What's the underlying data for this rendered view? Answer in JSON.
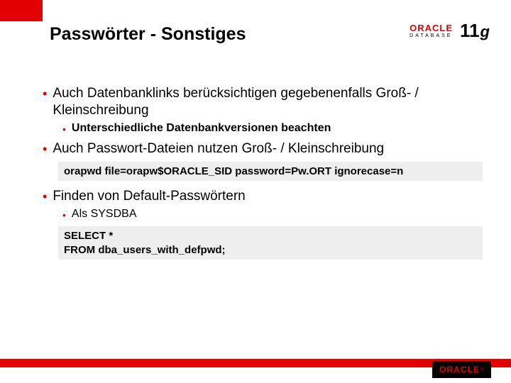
{
  "brand": {
    "wordmark": "ORACLE",
    "subtitle": "DATABASE",
    "version_number": "11",
    "version_suffix": "g",
    "registered": "®"
  },
  "title": "Passwörter - Sonstiges",
  "bullets": [
    {
      "level": 1,
      "text": "Auch Datenbanklinks berücksichtigen gegebenenfalls Groß- / Kleinschreibung"
    },
    {
      "level": 2,
      "text": "Unterschiedliche Datenbankversionen beachten",
      "bold": true
    },
    {
      "level": 1,
      "text": "Auch Passwort-Dateien nutzen Groß- / Kleinschreibung"
    }
  ],
  "code1": "orapwd file=orapw$ORACLE_SID password=Pw.ORT ignorecase=n",
  "bullets2": [
    {
      "level": 1,
      "text": "Finden von Default-Passwörtern"
    },
    {
      "level": 2,
      "text": "Als SYSDBA",
      "bold": false
    }
  ],
  "code2_line1": "SELECT *",
  "code2_line2": "FROM dba_users_with_defpwd;"
}
